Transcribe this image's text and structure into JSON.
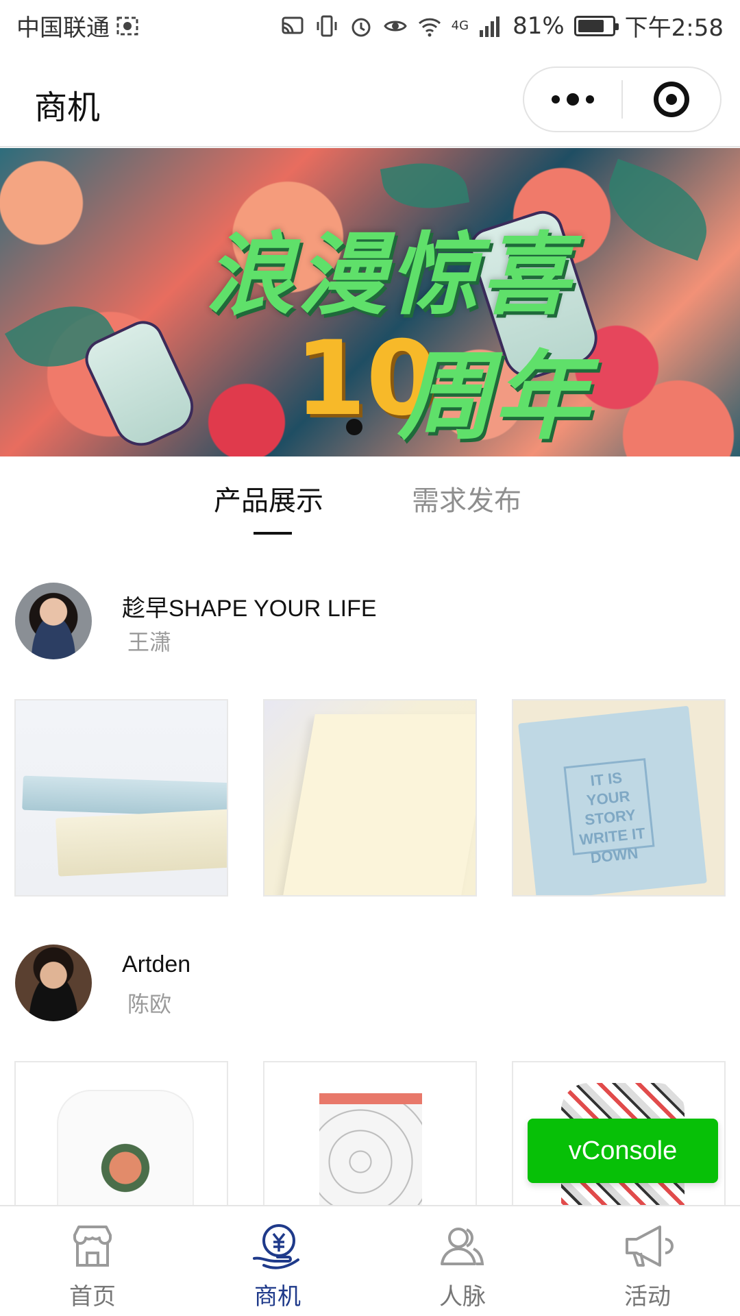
{
  "status_bar": {
    "carrier": "中国联通",
    "network": "4G",
    "battery": "81%",
    "time": "下午2:58"
  },
  "nav": {
    "title": "商机"
  },
  "banner": {
    "line1": "浪漫惊喜",
    "number": "10",
    "line2": "周年"
  },
  "tabs": {
    "products": "产品展示",
    "demand": "需求发布",
    "active": "products"
  },
  "merchants": [
    {
      "name": "趁早SHAPE YOUR LIFE",
      "person": "王潇"
    },
    {
      "name": "Artden",
      "person": "陈欧"
    }
  ],
  "thumb_text": {
    "book_stamp": "IT IS YOUR STORY WRITE IT DOWN"
  },
  "vconsole": {
    "label": "vConsole",
    "color": "#07c007"
  },
  "tabbar": {
    "items": [
      {
        "label": "首页",
        "icon": "store-icon"
      },
      {
        "label": "商机",
        "icon": "yuan-hand-icon"
      },
      {
        "label": "人脉",
        "icon": "people-icon"
      },
      {
        "label": "活动",
        "icon": "megaphone-icon"
      }
    ],
    "active_index": 1,
    "active_color": "#1f3a8a"
  }
}
